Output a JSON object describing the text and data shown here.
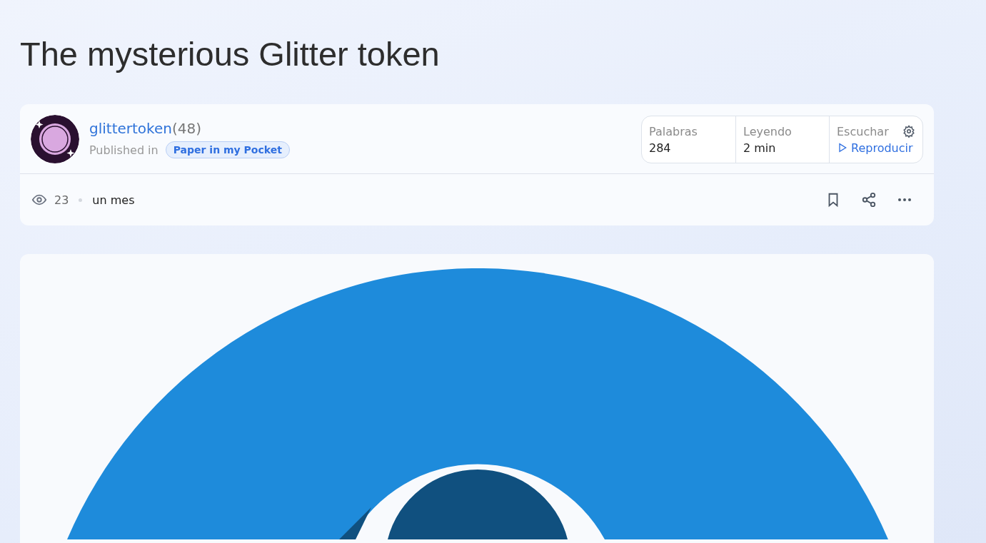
{
  "title": "The mysterious Glitter token",
  "author": {
    "name": "glittertoken",
    "count": "(48)",
    "published_label": "Published in",
    "publication": "Paper in my Pocket"
  },
  "stats": [
    {
      "kind": "text",
      "label": "Palabras",
      "value": "284"
    },
    {
      "kind": "text",
      "label": "Leyendo",
      "value": "2 min"
    },
    {
      "kind": "audio",
      "label": "Escuchar",
      "value": "Reproducir"
    }
  ],
  "meta": {
    "views": "23",
    "time": "un mes"
  }
}
